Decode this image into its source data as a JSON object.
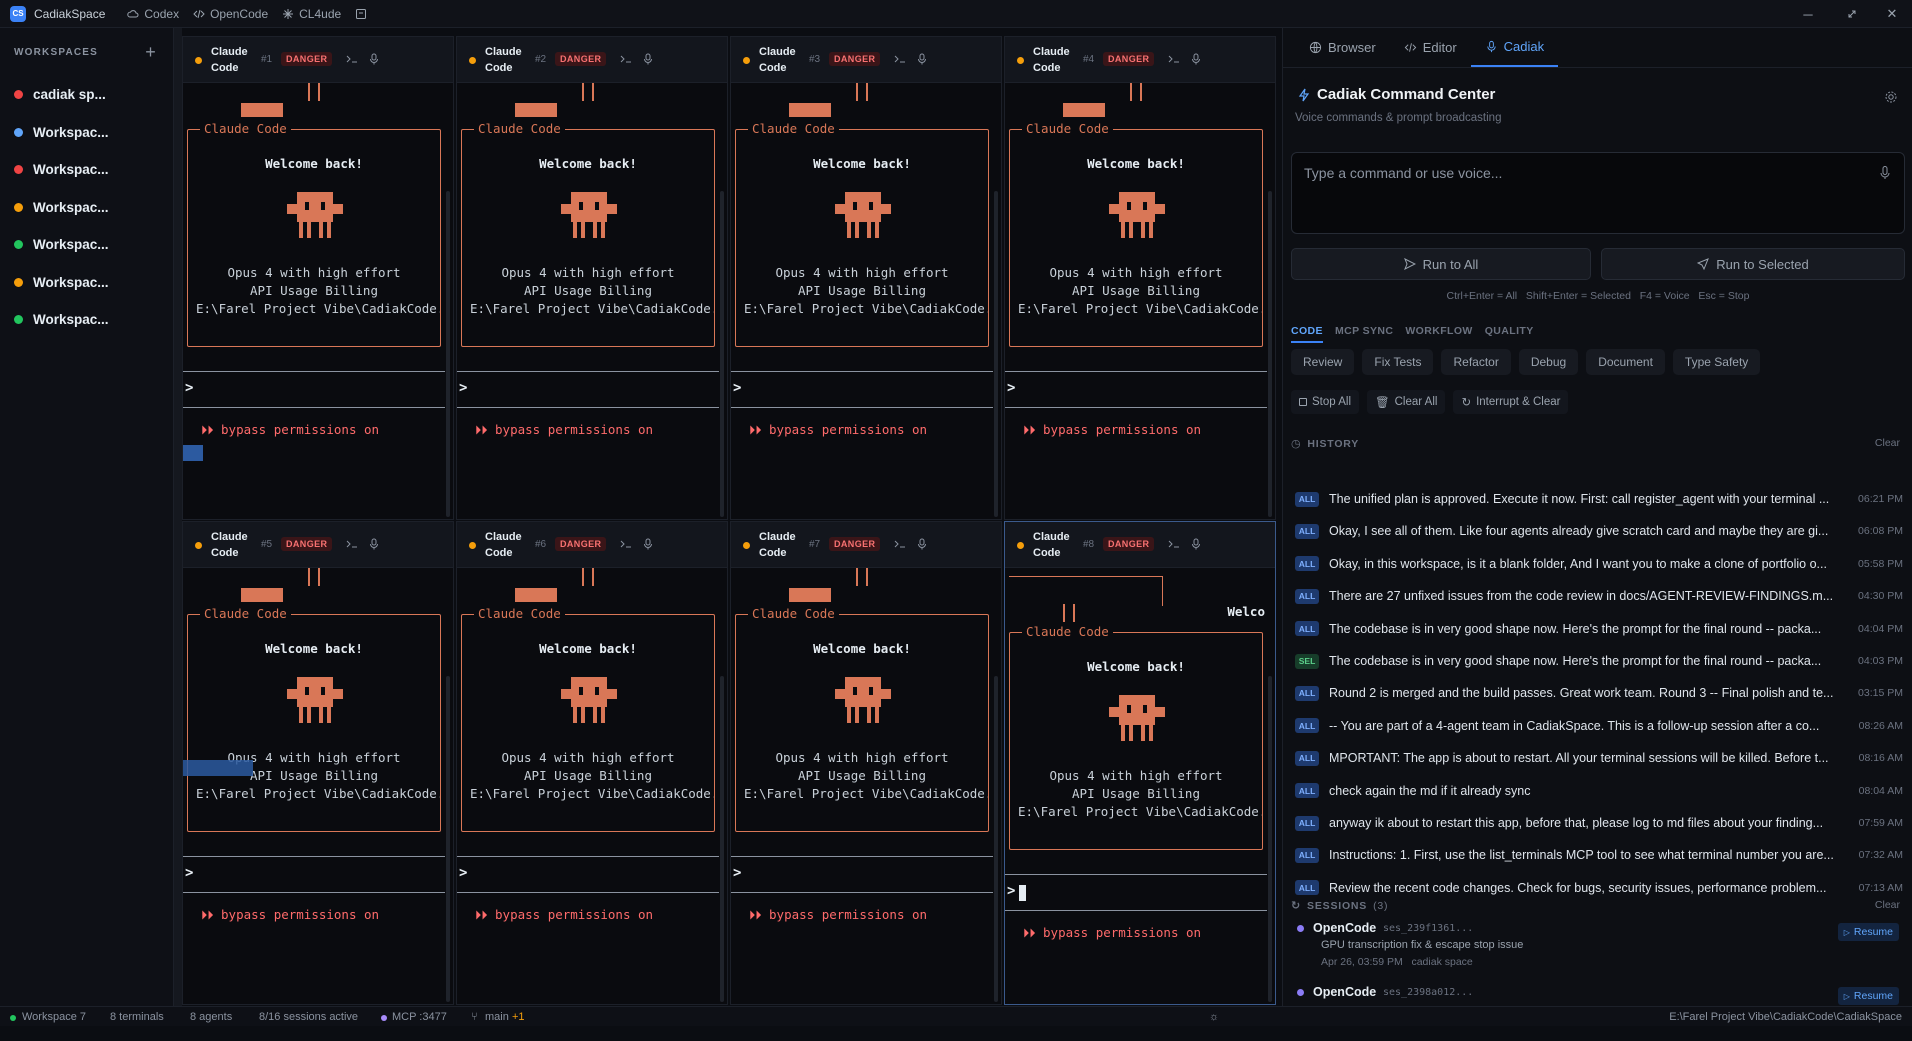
{
  "app": {
    "title": "CadiakSpace",
    "logo": "CS",
    "tabs": [
      "Codex",
      "OpenCode",
      "CL4ude"
    ]
  },
  "sidebar": {
    "header": "WORKSPACES",
    "add": "+",
    "items": [
      {
        "label": "cadiak sp...",
        "color": "#ef4444"
      },
      {
        "label": "Workspac...",
        "color": "#60a5fa"
      },
      {
        "label": "Workspac...",
        "color": "#ef4444"
      },
      {
        "label": "Workspac...",
        "color": "#f59e0b"
      },
      {
        "label": "Workspac...",
        "color": "#22c55e"
      },
      {
        "label": "Workspac...",
        "color": "#f59e0b"
      },
      {
        "label": "Workspac...",
        "color": "#22c55e"
      }
    ]
  },
  "terminal": {
    "name": "Claude Code",
    "danger": "DANGER",
    "box_label": "Claude Code",
    "welcome": "Welcome back!",
    "model": "Opus 4 with high effort",
    "billing": "API Usage Billing",
    "path": "E:\\Farel Project Vibe\\CadiakCode...",
    "prompt": ">",
    "bypass": "⏵⏵ bypass permissions on",
    "overflow_welcome": "Welco",
    "numbers": [
      "#1",
      "#2",
      "#3",
      "#4",
      "#5",
      "#6",
      "#7",
      "#8"
    ]
  },
  "right_panel": {
    "tabs": [
      "Browser",
      "Editor",
      "Cadiak"
    ],
    "title": "Cadiak Command Center",
    "subtitle": "Voice commands & prompt broadcasting",
    "input_placeholder": "Type a command or use voice...",
    "run_all": "Run to All",
    "run_selected": "Run to Selected",
    "shortcuts": "Ctrl+Enter = All   Shift+Enter = Selected   F4 = Voice   Esc = Stop",
    "subtabs": [
      "CODE",
      "MCP SYNC",
      "WORKFLOW",
      "QUALITY"
    ],
    "chips": [
      "Review",
      "Fix Tests",
      "Refactor",
      "Debug",
      "Document",
      "Type Safety"
    ],
    "actions": [
      "Stop All",
      "Clear All",
      "Interrupt & Clear"
    ],
    "history_label": "HISTORY",
    "clear": "Clear",
    "history": [
      {
        "badge": "ALL",
        "text": "The unified plan is approved. Execute it now. First: call register_agent with your terminal ...",
        "time": "06:21 PM"
      },
      {
        "badge": "ALL",
        "text": "Okay, I see all of them. Like four agents already give scratch card and maybe they are gi...",
        "time": "06:08 PM"
      },
      {
        "badge": "ALL",
        "text": "Okay, in this workspace, is it a blank folder, And I want you to make a clone of portfolio o...",
        "time": "05:58 PM"
      },
      {
        "badge": "ALL",
        "text": "There are 27 unfixed issues from the code review in docs/AGENT-REVIEW-FINDINGS.m...",
        "time": "04:30 PM"
      },
      {
        "badge": "ALL",
        "text": "The codebase is in very good shape now. Here's the prompt for the final round -- packa...",
        "time": "04:04 PM"
      },
      {
        "badge": "SEL",
        "text": "The codebase is in very good shape now. Here's the prompt for the final round -- packa...",
        "time": "04:03 PM"
      },
      {
        "badge": "ALL",
        "text": "Round 2 is merged and the build passes. Great work team. Round 3 -- Final polish and te...",
        "time": "03:15 PM"
      },
      {
        "badge": "ALL",
        "text": "-- You are part of a 4-agent team in CadiakSpace. This is a follow-up session after a co...",
        "time": "08:26 AM"
      },
      {
        "badge": "ALL",
        "text": "MPORTANT: The app is about to restart. All your terminal sessions will be killed. Before t...",
        "time": "08:16 AM"
      },
      {
        "badge": "ALL",
        "text": "check again the md if it already sync",
        "time": "08:04 AM"
      },
      {
        "badge": "ALL",
        "text": "anyway ik about to restart this app, before that, please log to md files about your finding...",
        "time": "07:59 AM"
      },
      {
        "badge": "ALL",
        "text": "Instructions: 1. First, use the list_terminals MCP tool to see what terminal number you are...",
        "time": "07:32 AM"
      },
      {
        "badge": "ALL",
        "text": "Review the recent code changes. Check for bugs, security issues, performance problem...",
        "time": "07:13 AM"
      }
    ],
    "sessions_label": "SESSIONS",
    "sessions_count": "(3)",
    "sessions": [
      {
        "name": "OpenCode",
        "id": "ses_239f1361...",
        "desc": "GPU transcription fix & escape stop issue",
        "meta": "Apr 26, 03:59 PM   cadiak space",
        "resume": "Resume"
      },
      {
        "name": "OpenCode",
        "id": "ses_2398a012...",
        "desc": "",
        "meta": "",
        "resume": "Resume"
      }
    ]
  },
  "statusbar": {
    "workspace": "Workspace 7",
    "terminals": "8 terminals",
    "agents": "8 agents",
    "sessions": "8/16 sessions active",
    "mcp": "MCP :3477",
    "branch": "main",
    "branch_delta": "+1",
    "path": "E:\\Farel Project Vibe\\CadiakCode\\CadiakSpace"
  }
}
